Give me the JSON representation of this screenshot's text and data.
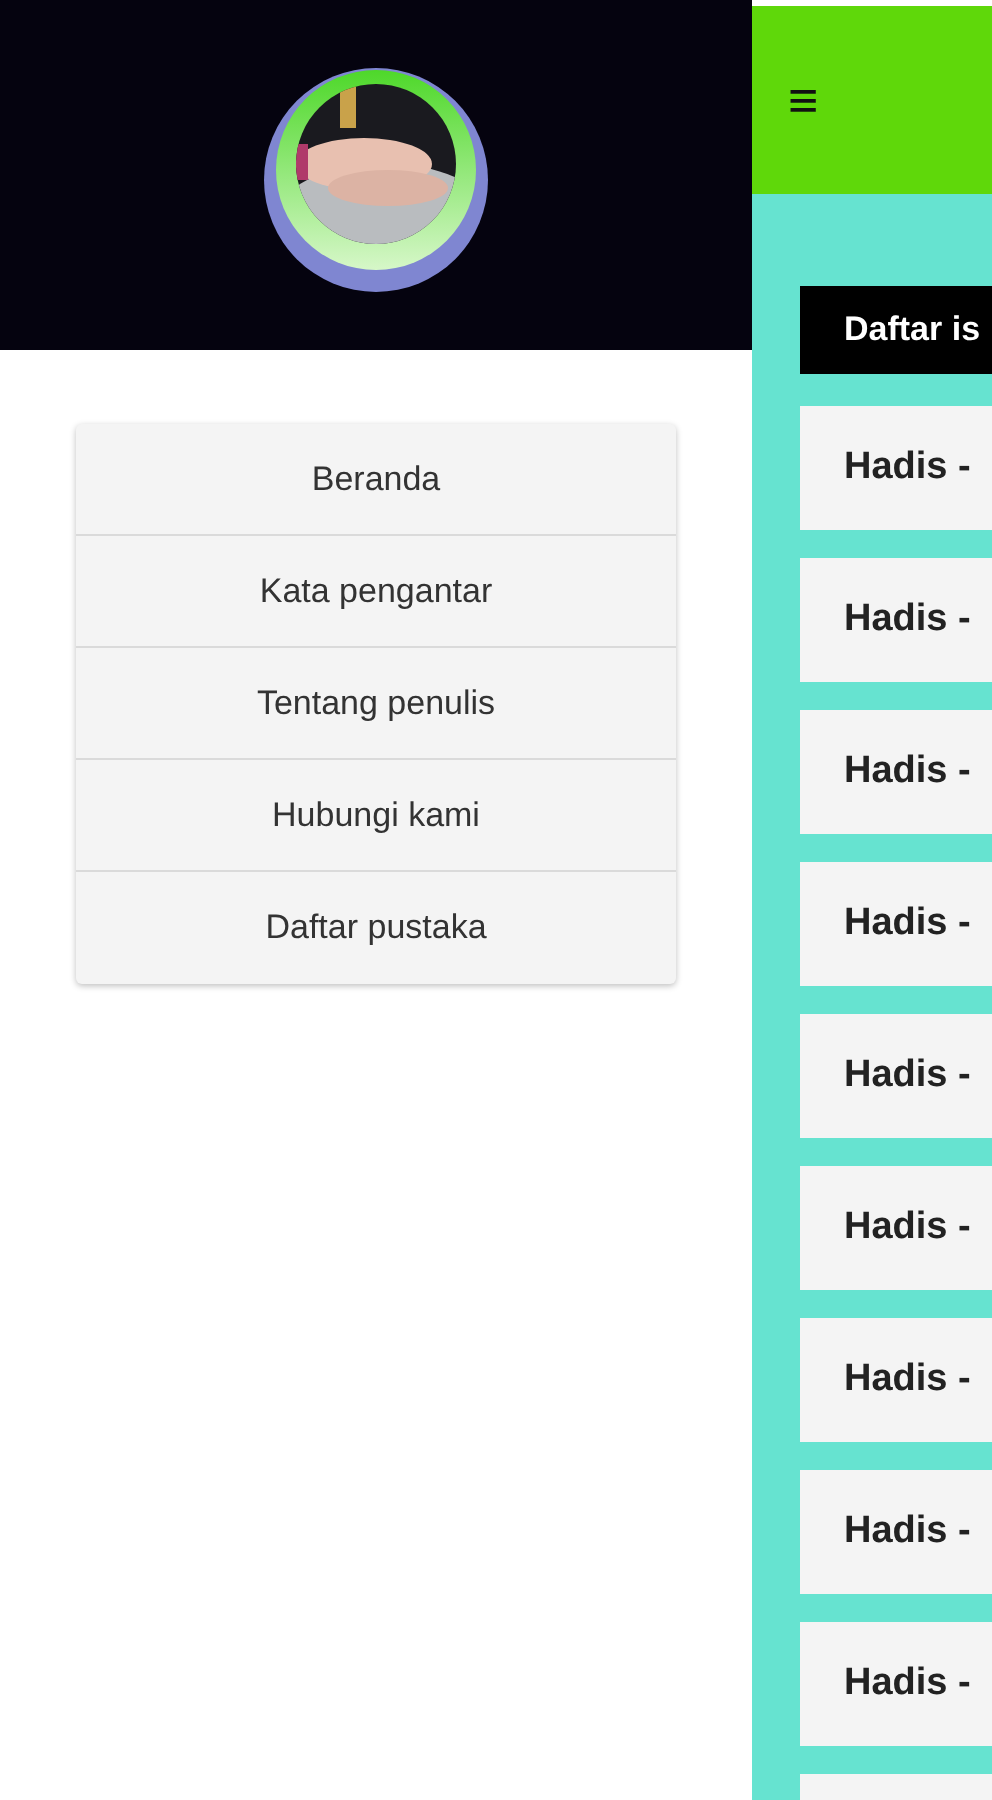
{
  "drawer": {
    "menu": [
      {
        "label": "Beranda"
      },
      {
        "label": "Kata pengantar"
      },
      {
        "label": "Tentang penulis"
      },
      {
        "label": "Hubungi kami"
      },
      {
        "label": "Daftar pustaka"
      }
    ]
  },
  "app_bar": {
    "menu_icon": "≡"
  },
  "content": {
    "heading": "Daftar is",
    "items": [
      {
        "title": "Hadis -"
      },
      {
        "title": "Hadis -"
      },
      {
        "title": "Hadis -"
      },
      {
        "title": "Hadis -"
      },
      {
        "title": "Hadis -"
      },
      {
        "title": "Hadis -"
      },
      {
        "title": "Hadis -"
      },
      {
        "title": "Hadis -"
      },
      {
        "title": "Hadis -"
      }
    ]
  }
}
